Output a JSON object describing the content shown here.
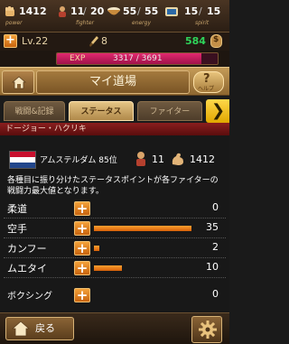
{
  "status": {
    "power": {
      "current": "1412",
      "caption": "power"
    },
    "fighter": {
      "current": "11",
      "max": "20",
      "caption": "fighter"
    },
    "energy": {
      "current": "55",
      "max": "55",
      "caption": "energy"
    },
    "spirit": {
      "current": "15",
      "max": "15",
      "caption": "spirit"
    }
  },
  "level": {
    "label": "Lv.22",
    "points": "8",
    "coins": "584"
  },
  "exp": {
    "label": "EXP",
    "value": "3317 / 3691",
    "progress": 0.9
  },
  "dojo": {
    "title": "マイ道場",
    "help_label": "ヘルプ"
  },
  "tabs": [
    {
      "label": "戦闘&記録",
      "active": false
    },
    {
      "label": "ステータス",
      "active": true
    },
    {
      "label": "ファイター",
      "active": false
    }
  ],
  "section": {
    "header": "ドージョー・ハクリキ",
    "city": "アムステルダム",
    "rank": "85位",
    "fighters": "11",
    "power": "1412",
    "description": "各種目に振り分けたステータスポイントが各ファイターの戦闘力最大値となります。"
  },
  "skills": [
    {
      "name": "柔道",
      "value": "0",
      "level": 0
    },
    {
      "name": "空手",
      "value": "35",
      "level": 35
    },
    {
      "name": "カンフー",
      "value": "2",
      "level": 2
    },
    {
      "name": "ムエタイ",
      "value": "10",
      "level": 10
    },
    {
      "name": "ボクシング",
      "value": "0",
      "level": 0
    }
  ],
  "skill_max": 35,
  "footer": {
    "back_label": "戻る"
  },
  "colors": {
    "accent_orange": "#f08a1c",
    "exp_pink": "#e2286f",
    "coin_green": "#2fd45a",
    "section_red": "#8a1e1e",
    "tab_arrow_yellow": "#ffd84a"
  }
}
